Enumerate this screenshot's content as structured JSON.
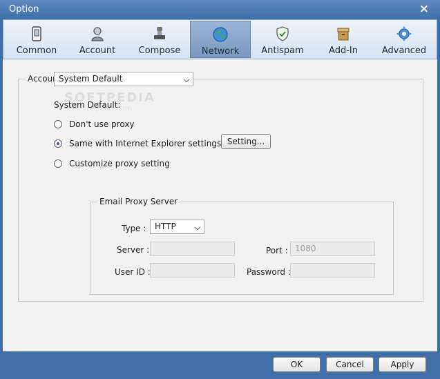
{
  "window": {
    "title": "Option"
  },
  "toolbar": {
    "items": [
      {
        "label": "Common",
        "icon": "phone-icon"
      },
      {
        "label": "Account",
        "icon": "user-icon"
      },
      {
        "label": "Compose",
        "icon": "stamp-icon"
      },
      {
        "label": "Network",
        "icon": "globe-icon",
        "active": true
      },
      {
        "label": "Antispam",
        "icon": "shield-icon"
      },
      {
        "label": "Add-In",
        "icon": "box-icon"
      },
      {
        "label": "Advanced",
        "icon": "gear-icon"
      }
    ]
  },
  "network": {
    "group_label": "Accour",
    "account_select": {
      "value": "System Default"
    },
    "watermark": {
      "main": "SOFTPEDIA",
      "url": "www.softpedia.com"
    },
    "section_label": "System Default:",
    "options": [
      {
        "label": "Don't use proxy",
        "checked": false
      },
      {
        "label": "Same with Internet Explorer settings",
        "checked": true
      },
      {
        "label": "Customize proxy setting",
        "checked": false
      }
    ],
    "setting_button": "Setting...",
    "proxy": {
      "title": "Email Proxy Server",
      "type_label": "Type :",
      "type_value": "HTTP",
      "server_label": "Server :",
      "server_value": "",
      "port_label": "Port :",
      "port_value": "1080",
      "userid_label": "User ID :",
      "userid_value": "",
      "password_label": "Password :",
      "password_value": ""
    }
  },
  "buttons": {
    "ok": "OK",
    "cancel": "Cancel",
    "apply": "Apply"
  }
}
